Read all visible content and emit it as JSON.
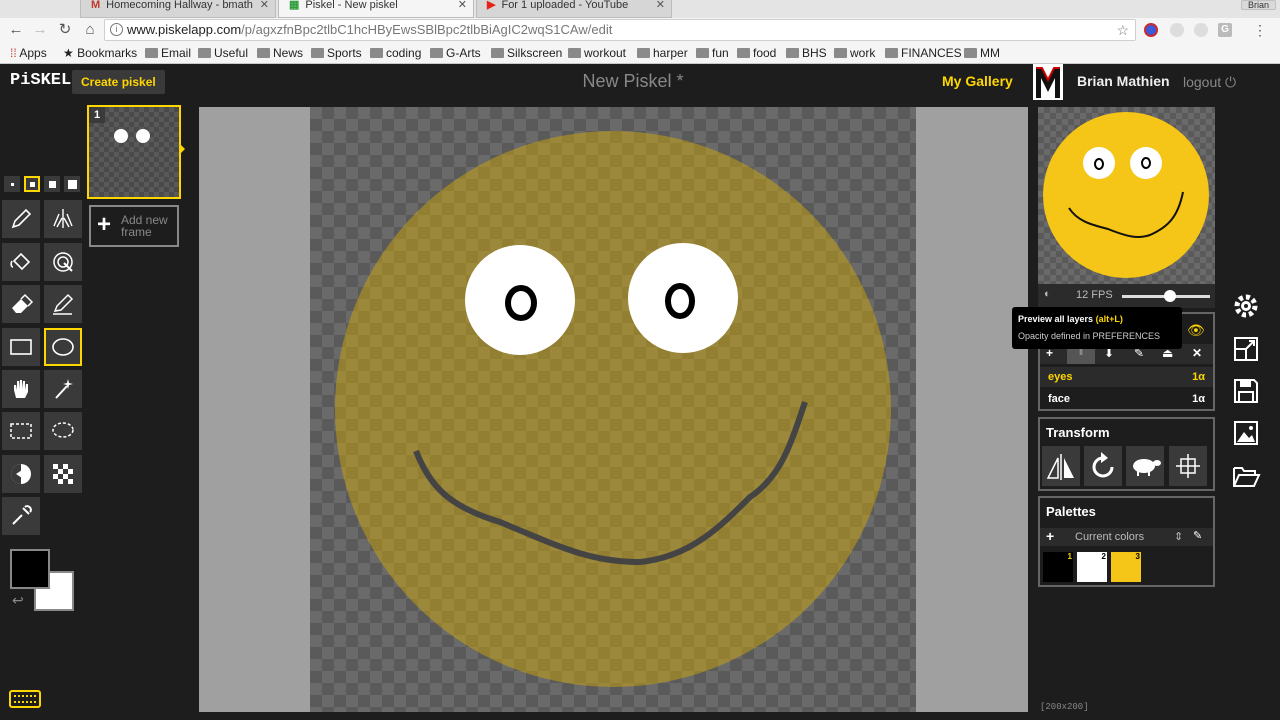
{
  "browser": {
    "tabs": [
      {
        "title": "Homecoming Hallway - bmath"
      },
      {
        "title": "Piskel - New piskel"
      },
      {
        "title": "For 1 uploaded - YouTube"
      }
    ],
    "user_chip": "Brian",
    "url_host": "www.piskelapp.com",
    "url_path": "/p/agxzfnBpc2tlbC1hcHByEwsSBlBpc2tlbBiAgIC2wqS1CAw/edit",
    "bookmarks": [
      "Apps",
      "Bookmarks",
      "Email",
      "Useful",
      "News",
      "Sports",
      "coding",
      "G-Arts",
      "Silkscreen",
      "workout",
      "harper",
      "fun",
      "food",
      "BHS",
      "work",
      "FINANCES",
      "MM"
    ]
  },
  "app": {
    "logo": "PiSKEL",
    "create_label": "Create piskel",
    "title": "New Piskel *",
    "gallery_label": "My Gallery",
    "username": "Brian Mathien",
    "logout_label": "logout",
    "accent_color": "#ffd700"
  },
  "tools": {
    "selected": "ellipse-tool",
    "pen_sizes": [
      1,
      2,
      3,
      4
    ],
    "selected_pen_size": 2,
    "primary_color": "#000000",
    "secondary_color": "#ffffff"
  },
  "frames": {
    "items": [
      {
        "number": "1"
      }
    ],
    "add_label_line1": "Add new",
    "add_label_line2": "frame"
  },
  "preview": {
    "fps_label": "12 FPS",
    "fps_fraction": 0.55
  },
  "tooltip": {
    "line1": "Preview all layers",
    "shortcut": "(alt+L)",
    "line2": "Opacity defined in PREFERENCES"
  },
  "layers": {
    "items": [
      {
        "name": "eyes",
        "alpha": "1α",
        "selected": true
      },
      {
        "name": "face",
        "alpha": "1α",
        "selected": false
      }
    ]
  },
  "transform": {
    "title": "Transform"
  },
  "palettes": {
    "title": "Palettes",
    "selected": "Current colors",
    "colors": [
      {
        "index": "1",
        "hex": "#000000"
      },
      {
        "index": "2",
        "hex": "#ffffff"
      },
      {
        "index": "3",
        "hex": "#f5c518"
      }
    ]
  },
  "status": {
    "dimensions": "[200x200]"
  }
}
